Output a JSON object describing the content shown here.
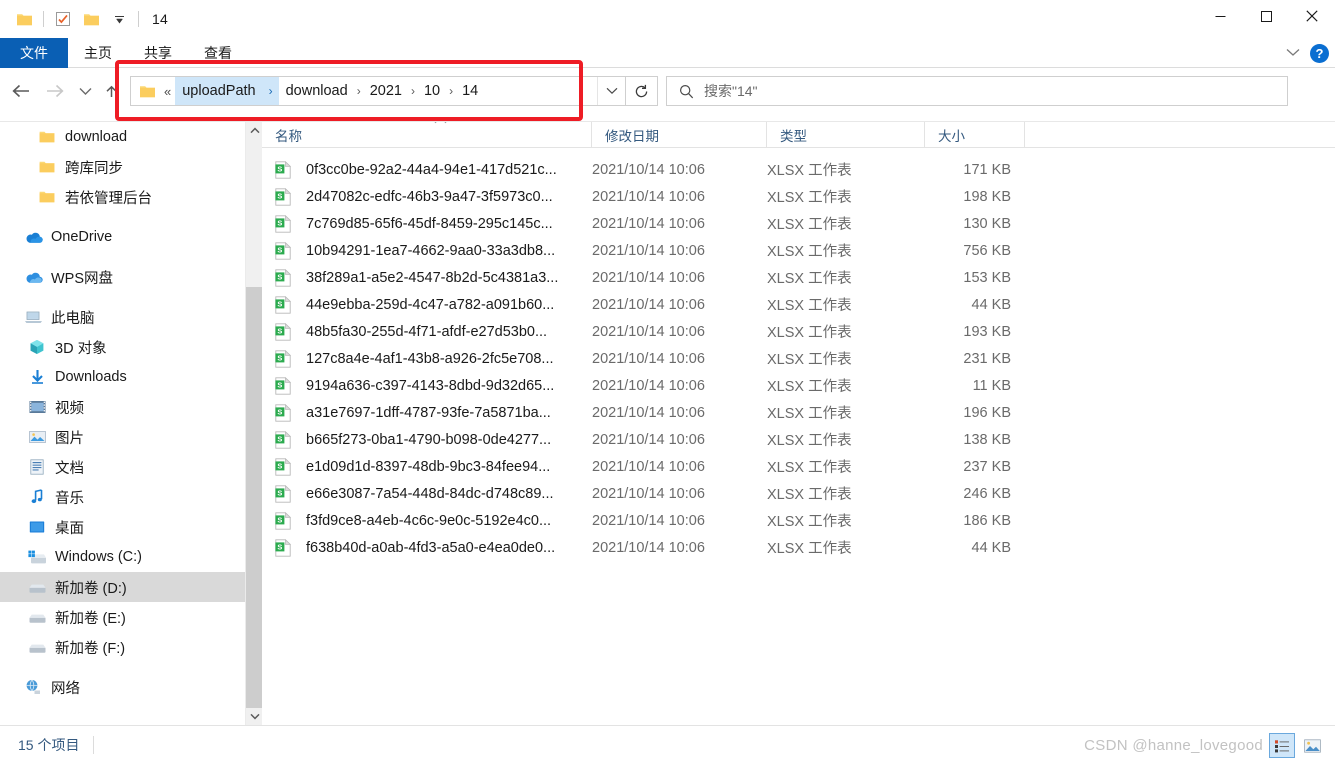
{
  "window": {
    "title": "14",
    "quick_access": [
      {
        "name": "folder-icon",
        "label": "folder"
      },
      {
        "name": "properties-icon",
        "label": "properties"
      },
      {
        "name": "new-folder-icon",
        "label": "new folder"
      },
      {
        "name": "customize-qat-icon",
        "label": "customize"
      }
    ],
    "controls": {
      "minimize": "─",
      "maximize": "☐",
      "close": "✕"
    }
  },
  "ribbon": {
    "tabs": [
      {
        "label": "文件",
        "active": true
      },
      {
        "label": "主页",
        "active": false
      },
      {
        "label": "共享",
        "active": false
      },
      {
        "label": "查看",
        "active": false
      }
    ],
    "collapse_icon": "chevron-down-icon",
    "help_label": "?"
  },
  "nav": {
    "back_icon": "←",
    "forward_icon": "→",
    "recent_icon": "⌄",
    "up_icon": "↑",
    "refresh_icon": "↻",
    "address_dropdown_icon": "⌄"
  },
  "address": {
    "leading": "«",
    "crumbs": [
      {
        "label": "uploadPath",
        "selected": true
      },
      {
        "label": "download",
        "selected": false
      },
      {
        "label": "2021",
        "selected": false
      },
      {
        "label": "10",
        "selected": false
      },
      {
        "label": "14",
        "selected": false
      }
    ]
  },
  "search": {
    "placeholder": "搜索\"14\"",
    "value": ""
  },
  "sidebar": {
    "groups": [
      {
        "items": [
          {
            "label": "download",
            "icon": "folder-icon",
            "indent": 1,
            "selected": false
          },
          {
            "label": "跨库同步",
            "icon": "folder-icon",
            "indent": 1,
            "selected": false
          },
          {
            "label": "若依管理后台",
            "icon": "folder-icon",
            "indent": 1,
            "selected": false
          }
        ]
      },
      {
        "items": [
          {
            "label": "OneDrive",
            "icon": "onedrive-cloud-icon",
            "indent": 0,
            "selected": false
          }
        ]
      },
      {
        "items": [
          {
            "label": "WPS网盘",
            "icon": "wps-cloud-icon",
            "indent": 0,
            "selected": false
          }
        ]
      },
      {
        "items": [
          {
            "label": "此电脑",
            "icon": "this-pc-icon",
            "indent": 0,
            "selected": false
          },
          {
            "label": "3D 对象",
            "icon": "3d-objects-icon",
            "indent": 2,
            "selected": false
          },
          {
            "label": "Downloads",
            "icon": "downloads-icon",
            "indent": 2,
            "selected": false
          },
          {
            "label": "视频",
            "icon": "videos-icon",
            "indent": 2,
            "selected": false
          },
          {
            "label": "图片",
            "icon": "pictures-icon",
            "indent": 2,
            "selected": false
          },
          {
            "label": "文档",
            "icon": "documents-icon",
            "indent": 2,
            "selected": false
          },
          {
            "label": "音乐",
            "icon": "music-icon",
            "indent": 2,
            "selected": false
          },
          {
            "label": "桌面",
            "icon": "desktop-icon",
            "indent": 2,
            "selected": false
          },
          {
            "label": "Windows (C:)",
            "icon": "windows-drive-icon",
            "indent": 2,
            "selected": false
          },
          {
            "label": "新加卷 (D:)",
            "icon": "drive-icon",
            "indent": 2,
            "selected": true
          },
          {
            "label": "新加卷 (E:)",
            "icon": "drive-icon",
            "indent": 2,
            "selected": false
          },
          {
            "label": "新加卷 (F:)",
            "icon": "drive-icon",
            "indent": 2,
            "selected": false
          }
        ]
      },
      {
        "items": [
          {
            "label": "网络",
            "icon": "network-icon",
            "indent": 0,
            "selected": false
          }
        ]
      }
    ]
  },
  "filelist": {
    "columns": [
      {
        "key": "name",
        "label": "名称",
        "sorted": true
      },
      {
        "key": "date",
        "label": "修改日期",
        "sorted": false
      },
      {
        "key": "type",
        "label": "类型",
        "sorted": false
      },
      {
        "key": "size",
        "label": "大小",
        "sorted": false
      }
    ],
    "rows": [
      {
        "name": "0f3cc0be-92a2-44a4-94e1-417d521c...",
        "date": "2021/10/14 10:06",
        "type": "XLSX 工作表",
        "size": "171 KB",
        "icon": "xlsx-file-icon"
      },
      {
        "name": "2d47082c-edfc-46b3-9a47-3f5973c0...",
        "date": "2021/10/14 10:06",
        "type": "XLSX 工作表",
        "size": "198 KB",
        "icon": "xlsx-file-icon"
      },
      {
        "name": "7c769d85-65f6-45df-8459-295c145c...",
        "date": "2021/10/14 10:06",
        "type": "XLSX 工作表",
        "size": "130 KB",
        "icon": "xlsx-file-icon"
      },
      {
        "name": "10b94291-1ea7-4662-9aa0-33a3db8...",
        "date": "2021/10/14 10:06",
        "type": "XLSX 工作表",
        "size": "756 KB",
        "icon": "xlsx-file-icon"
      },
      {
        "name": "38f289a1-a5e2-4547-8b2d-5c4381a3...",
        "date": "2021/10/14 10:06",
        "type": "XLSX 工作表",
        "size": "153 KB",
        "icon": "xlsx-file-icon"
      },
      {
        "name": "44e9ebba-259d-4c47-a782-a091b60...",
        "date": "2021/10/14 10:06",
        "type": "XLSX 工作表",
        "size": "44 KB",
        "icon": "xlsx-file-icon"
      },
      {
        "name": "48b5fa30-255d-4f71-afdf-e27d53b0...",
        "date": "2021/10/14 10:06",
        "type": "XLSX 工作表",
        "size": "193 KB",
        "icon": "xlsx-file-icon"
      },
      {
        "name": "127c8a4e-4af1-43b8-a926-2fc5e708...",
        "date": "2021/10/14 10:06",
        "type": "XLSX 工作表",
        "size": "231 KB",
        "icon": "xlsx-file-icon"
      },
      {
        "name": "9194a636-c397-4143-8dbd-9d32d65...",
        "date": "2021/10/14 10:06",
        "type": "XLSX 工作表",
        "size": "11 KB",
        "icon": "xlsx-file-icon"
      },
      {
        "name": "a31e7697-1dff-4787-93fe-7a5871ba...",
        "date": "2021/10/14 10:06",
        "type": "XLSX 工作表",
        "size": "196 KB",
        "icon": "xlsx-file-icon"
      },
      {
        "name": "b665f273-0ba1-4790-b098-0de4277...",
        "date": "2021/10/14 10:06",
        "type": "XLSX 工作表",
        "size": "138 KB",
        "icon": "xlsx-file-icon"
      },
      {
        "name": "e1d09d1d-8397-48db-9bc3-84fee94...",
        "date": "2021/10/14 10:06",
        "type": "XLSX 工作表",
        "size": "237 KB",
        "icon": "xlsx-file-icon"
      },
      {
        "name": "e66e3087-7a54-448d-84dc-d748c89...",
        "date": "2021/10/14 10:06",
        "type": "XLSX 工作表",
        "size": "246 KB",
        "icon": "xlsx-file-icon"
      },
      {
        "name": "f3fd9ce8-a4eb-4c6c-9e0c-5192e4c0...",
        "date": "2021/10/14 10:06",
        "type": "XLSX 工作表",
        "size": "186 KB",
        "icon": "xlsx-file-icon"
      },
      {
        "name": "f638b40d-a0ab-4fd3-a5a0-e4ea0de0...",
        "date": "2021/10/14 10:06",
        "type": "XLSX 工作表",
        "size": "44 KB",
        "icon": "xlsx-file-icon"
      }
    ]
  },
  "statusbar": {
    "item_count": "15 个项目",
    "views": [
      {
        "name": "details-view-button",
        "active": true
      },
      {
        "name": "large-icons-view-button",
        "active": false
      }
    ]
  },
  "watermark": {
    "text": "CSDN @hanne_lovegood"
  },
  "annotation": {
    "color": "#ee1c25",
    "target": "address-bar"
  }
}
